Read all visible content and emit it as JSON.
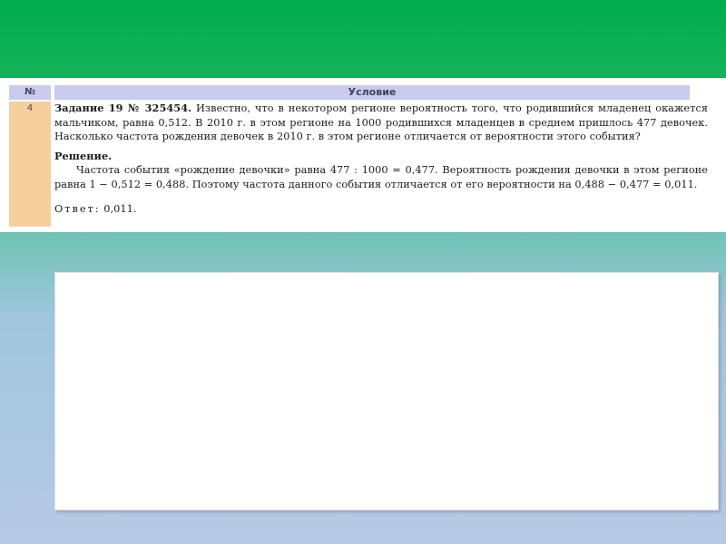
{
  "table": {
    "header_num": "№",
    "header_condition": "Условие",
    "row_num": "4",
    "task_label": "Задание 19 № 325454.",
    "task_text": "Известно, что в некотором регионе вероятность того, что родившийся младенец окажется мальчиком, равна 0,512. В 2010 г. в этом регионе на 1000 родившихся младенцев в среднем пришлось 477 девочек. Насколько частота рождения девочек в 2010 г. в этом регионе отличается от вероятности этого события?",
    "solution_heading": "Решение.",
    "solution_text": "Частота события «рождение девочки» равна 477 : 1000 = 0,477. Вероятность рождения девочки в этом регионе равна 1 − 0,512 = 0,488. Поэтому частота данного события отличается от его вероятности на 0,488 − 0,477 = 0,011.",
    "answer_label": "Ответ:",
    "answer_value": "0,011."
  },
  "colors": {
    "header_bg": "#c9cbee",
    "number_cell_bg": "#f7cf9e",
    "slide_top": "#00ad4e",
    "slide_bottom": "#b7c9e6"
  }
}
